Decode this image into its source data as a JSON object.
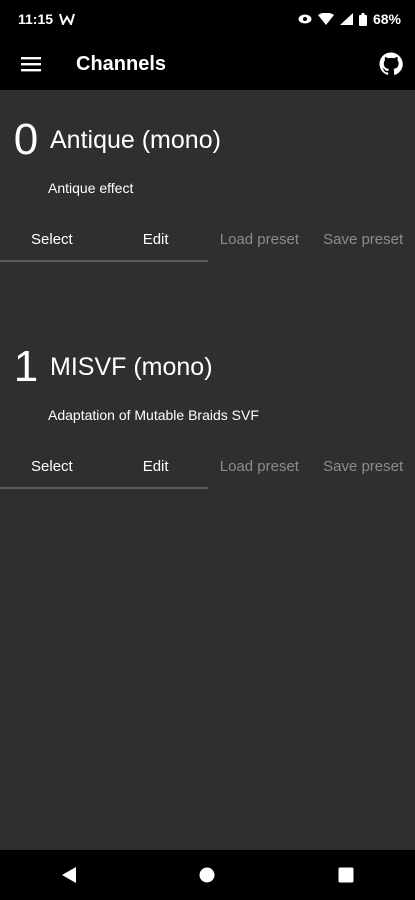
{
  "status": {
    "time": "11:15",
    "battery": "68%"
  },
  "appbar": {
    "title": "Channels"
  },
  "channels": [
    {
      "number": "0",
      "name": "Antique (mono)",
      "description": "Antique effect",
      "actions": {
        "select": "Select",
        "edit": "Edit",
        "load": "Load preset",
        "save": "Save preset"
      }
    },
    {
      "number": "1",
      "name": "MISVF (mono)",
      "description": "Adaptation of Mutable Braids SVF",
      "actions": {
        "select": "Select",
        "edit": "Edit",
        "load": "Load preset",
        "save": "Save preset"
      }
    }
  ],
  "icons": {
    "menu": "menu-icon",
    "github": "github-icon",
    "back": "back-icon",
    "home": "home-icon",
    "recents": "recents-icon"
  },
  "colors": {
    "background": "#2f2f2f",
    "bars": "#000000",
    "disabled_text": "#8c8c8c"
  }
}
